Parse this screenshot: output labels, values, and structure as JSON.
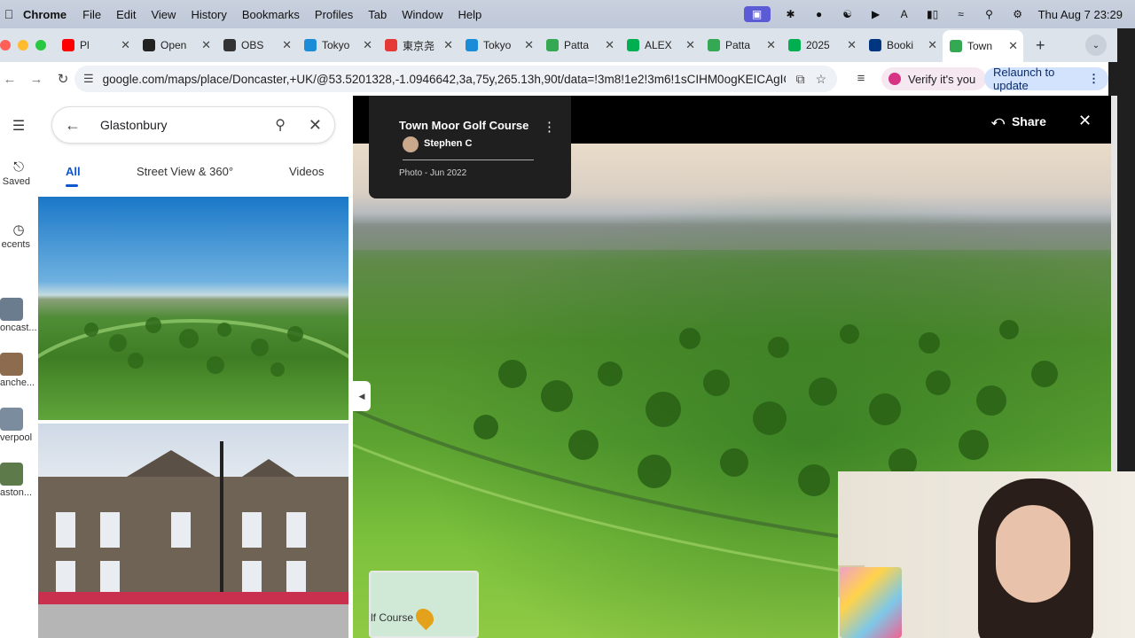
{
  "menubar": {
    "app": "Chrome",
    "items": [
      "File",
      "Edit",
      "View",
      "History",
      "Bookmarks",
      "Profiles",
      "Tab",
      "Window",
      "Help"
    ],
    "datetime": "Thu Aug 7  23:29"
  },
  "tabs": [
    {
      "title": "Pl",
      "color": "#ff0000",
      "icon": "youtube-icon"
    },
    {
      "title": "Open",
      "color": "#222222",
      "icon": "openai-icon"
    },
    {
      "title": "OBS",
      "color": "#333333",
      "icon": "obs-icon"
    },
    {
      "title": "Tokyo",
      "color": "#1a8cd8",
      "icon": "compass-icon"
    },
    {
      "title": "東京尧",
      "color": "#e53935",
      "icon": "site-icon"
    },
    {
      "title": "Tokyo",
      "color": "#1a8cd8",
      "icon": "compass-icon"
    },
    {
      "title": "Patta",
      "color": "#34a853",
      "icon": "maps-pin-icon"
    },
    {
      "title": "ALEX",
      "color": "#00b050",
      "icon": "site-icon"
    },
    {
      "title": "Patta",
      "color": "#34a853",
      "icon": "palm-icon"
    },
    {
      "title": "2025",
      "color": "#00b050",
      "icon": "site-icon"
    },
    {
      "title": "Booki",
      "color": "#003580",
      "icon": "booking-icon"
    },
    {
      "title": "Town",
      "color": "#34a853",
      "icon": "maps-pin-icon",
      "active": true
    }
  ],
  "address": {
    "url": "google.com/maps/place/Doncaster,+UK/@53.5201328,-1.0946642,3a,75y,265.13h,90t/data=!3m8!1e2!3m6!1sCIHM0ogKEICAgIC...",
    "verify_label": "Verify it's you",
    "relaunch_label": "Relaunch to update"
  },
  "rail": {
    "saved": "Saved",
    "recents": "ecents",
    "places": [
      {
        "label": "oncast...",
        "color": "#6b7c8f"
      },
      {
        "label": "anche...",
        "color": "#8c6b4f"
      },
      {
        "label": "verpool",
        "color": "#7a8c9e"
      },
      {
        "label": "aston...",
        "color": "#5c7a4a"
      }
    ]
  },
  "search": {
    "query": "Glastonbury",
    "chips": [
      "All",
      "Street View & 360°",
      "Videos"
    ]
  },
  "viewer": {
    "place_title": "Town Moor Golf Course",
    "author": "Stephen C",
    "photo_date": "Photo - Jun 2022",
    "share_label": "Share",
    "minimap_label": "lf Course"
  }
}
